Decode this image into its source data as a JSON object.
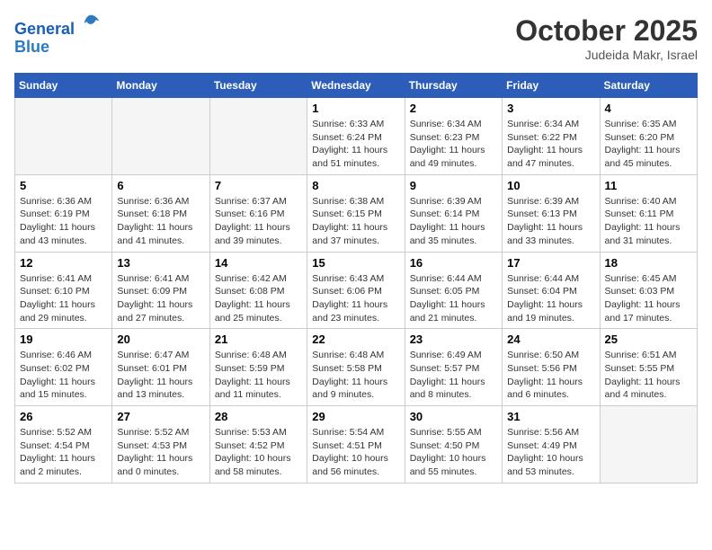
{
  "header": {
    "logo_line1": "General",
    "logo_line2": "Blue",
    "month": "October 2025",
    "location": "Judeida Makr, Israel"
  },
  "weekdays": [
    "Sunday",
    "Monday",
    "Tuesday",
    "Wednesday",
    "Thursday",
    "Friday",
    "Saturday"
  ],
  "weeks": [
    [
      {
        "day": "",
        "info": ""
      },
      {
        "day": "",
        "info": ""
      },
      {
        "day": "",
        "info": ""
      },
      {
        "day": "1",
        "info": "Sunrise: 6:33 AM\nSunset: 6:24 PM\nDaylight: 11 hours\nand 51 minutes."
      },
      {
        "day": "2",
        "info": "Sunrise: 6:34 AM\nSunset: 6:23 PM\nDaylight: 11 hours\nand 49 minutes."
      },
      {
        "day": "3",
        "info": "Sunrise: 6:34 AM\nSunset: 6:22 PM\nDaylight: 11 hours\nand 47 minutes."
      },
      {
        "day": "4",
        "info": "Sunrise: 6:35 AM\nSunset: 6:20 PM\nDaylight: 11 hours\nand 45 minutes."
      }
    ],
    [
      {
        "day": "5",
        "info": "Sunrise: 6:36 AM\nSunset: 6:19 PM\nDaylight: 11 hours\nand 43 minutes."
      },
      {
        "day": "6",
        "info": "Sunrise: 6:36 AM\nSunset: 6:18 PM\nDaylight: 11 hours\nand 41 minutes."
      },
      {
        "day": "7",
        "info": "Sunrise: 6:37 AM\nSunset: 6:16 PM\nDaylight: 11 hours\nand 39 minutes."
      },
      {
        "day": "8",
        "info": "Sunrise: 6:38 AM\nSunset: 6:15 PM\nDaylight: 11 hours\nand 37 minutes."
      },
      {
        "day": "9",
        "info": "Sunrise: 6:39 AM\nSunset: 6:14 PM\nDaylight: 11 hours\nand 35 minutes."
      },
      {
        "day": "10",
        "info": "Sunrise: 6:39 AM\nSunset: 6:13 PM\nDaylight: 11 hours\nand 33 minutes."
      },
      {
        "day": "11",
        "info": "Sunrise: 6:40 AM\nSunset: 6:11 PM\nDaylight: 11 hours\nand 31 minutes."
      }
    ],
    [
      {
        "day": "12",
        "info": "Sunrise: 6:41 AM\nSunset: 6:10 PM\nDaylight: 11 hours\nand 29 minutes."
      },
      {
        "day": "13",
        "info": "Sunrise: 6:41 AM\nSunset: 6:09 PM\nDaylight: 11 hours\nand 27 minutes."
      },
      {
        "day": "14",
        "info": "Sunrise: 6:42 AM\nSunset: 6:08 PM\nDaylight: 11 hours\nand 25 minutes."
      },
      {
        "day": "15",
        "info": "Sunrise: 6:43 AM\nSunset: 6:06 PM\nDaylight: 11 hours\nand 23 minutes."
      },
      {
        "day": "16",
        "info": "Sunrise: 6:44 AM\nSunset: 6:05 PM\nDaylight: 11 hours\nand 21 minutes."
      },
      {
        "day": "17",
        "info": "Sunrise: 6:44 AM\nSunset: 6:04 PM\nDaylight: 11 hours\nand 19 minutes."
      },
      {
        "day": "18",
        "info": "Sunrise: 6:45 AM\nSunset: 6:03 PM\nDaylight: 11 hours\nand 17 minutes."
      }
    ],
    [
      {
        "day": "19",
        "info": "Sunrise: 6:46 AM\nSunset: 6:02 PM\nDaylight: 11 hours\nand 15 minutes."
      },
      {
        "day": "20",
        "info": "Sunrise: 6:47 AM\nSunset: 6:01 PM\nDaylight: 11 hours\nand 13 minutes."
      },
      {
        "day": "21",
        "info": "Sunrise: 6:48 AM\nSunset: 5:59 PM\nDaylight: 11 hours\nand 11 minutes."
      },
      {
        "day": "22",
        "info": "Sunrise: 6:48 AM\nSunset: 5:58 PM\nDaylight: 11 hours\nand 9 minutes."
      },
      {
        "day": "23",
        "info": "Sunrise: 6:49 AM\nSunset: 5:57 PM\nDaylight: 11 hours\nand 8 minutes."
      },
      {
        "day": "24",
        "info": "Sunrise: 6:50 AM\nSunset: 5:56 PM\nDaylight: 11 hours\nand 6 minutes."
      },
      {
        "day": "25",
        "info": "Sunrise: 6:51 AM\nSunset: 5:55 PM\nDaylight: 11 hours\nand 4 minutes."
      }
    ],
    [
      {
        "day": "26",
        "info": "Sunrise: 5:52 AM\nSunset: 4:54 PM\nDaylight: 11 hours\nand 2 minutes."
      },
      {
        "day": "27",
        "info": "Sunrise: 5:52 AM\nSunset: 4:53 PM\nDaylight: 11 hours\nand 0 minutes."
      },
      {
        "day": "28",
        "info": "Sunrise: 5:53 AM\nSunset: 4:52 PM\nDaylight: 10 hours\nand 58 minutes."
      },
      {
        "day": "29",
        "info": "Sunrise: 5:54 AM\nSunset: 4:51 PM\nDaylight: 10 hours\nand 56 minutes."
      },
      {
        "day": "30",
        "info": "Sunrise: 5:55 AM\nSunset: 4:50 PM\nDaylight: 10 hours\nand 55 minutes."
      },
      {
        "day": "31",
        "info": "Sunrise: 5:56 AM\nSunset: 4:49 PM\nDaylight: 10 hours\nand 53 minutes."
      },
      {
        "day": "",
        "info": ""
      }
    ]
  ]
}
